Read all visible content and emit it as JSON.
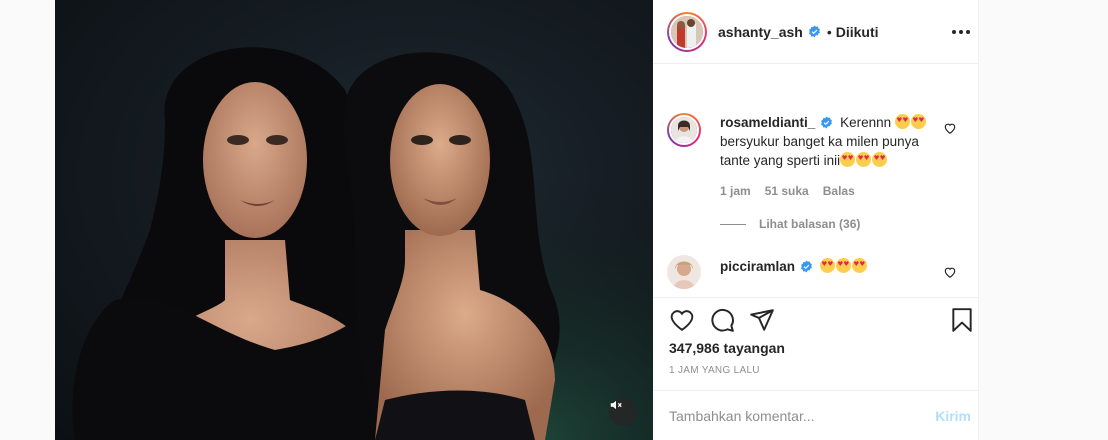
{
  "post": {
    "username": "ashanty_ash",
    "separator": "•",
    "follow_status": "Diikuti",
    "views_label": "347,986 tayangan",
    "time_label": "1 JAM YANG LALU"
  },
  "comments": [
    {
      "username": "rosameldianti_",
      "text_before": "Kerennn",
      "text_after": "bersyukur banget ka milen punya tante yang sperti inii",
      "time": "1 jam",
      "likes": "51 suka",
      "reply_label": "Balas",
      "view_replies": "Lihat balasan (36)"
    },
    {
      "username": "picciramlan",
      "text_before": ""
    }
  ],
  "compose": {
    "placeholder": "Tambahkan komentar...",
    "send_label": "Kirim"
  },
  "colors": {
    "accent": "#0095f6",
    "send_disabled": "#b2dffc",
    "verified": "#3897f0",
    "muted": "#8e8e8e"
  },
  "icons": [
    "more-options-icon",
    "verified-badge-icon",
    "heart-icon",
    "comment-icon",
    "share-icon",
    "bookmark-icon",
    "mute-icon",
    "heart-eyes-emoji"
  ]
}
